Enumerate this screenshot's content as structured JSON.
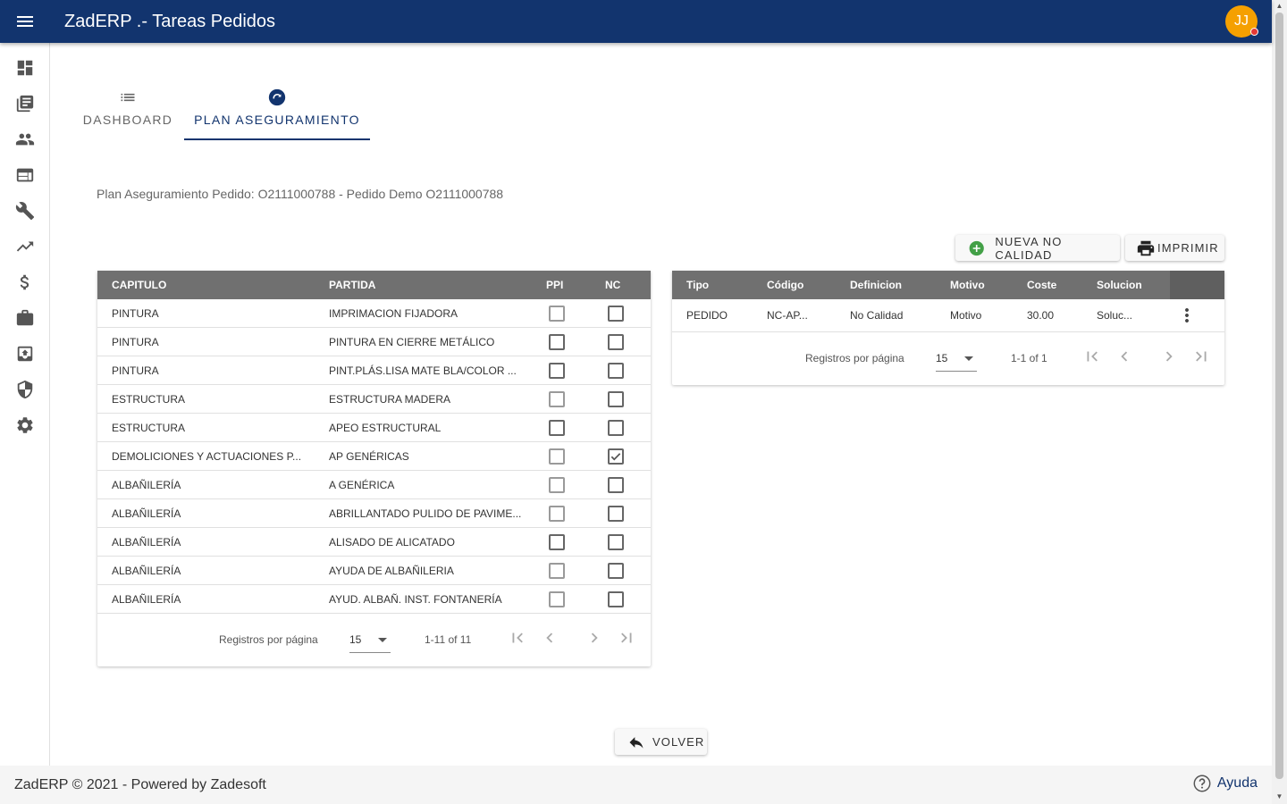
{
  "header": {
    "title": "ZadERP .- Tareas Pedidos",
    "avatar_initials": "JJ"
  },
  "sidebar": {
    "items": [
      {
        "name": "dashboard"
      },
      {
        "name": "library"
      },
      {
        "name": "people"
      },
      {
        "name": "web"
      },
      {
        "name": "wrench"
      },
      {
        "name": "trending"
      },
      {
        "name": "dollar"
      },
      {
        "name": "briefcase"
      },
      {
        "name": "archive"
      },
      {
        "name": "shield"
      },
      {
        "name": "settings"
      }
    ]
  },
  "tabs": [
    {
      "label": "DASHBOARD"
    },
    {
      "label": "PLAN ASEGURAMIENTO"
    }
  ],
  "subtitle": "Plan Aseguramiento Pedido: O2111000788 - Pedido Demo O2111000788",
  "actions": {
    "nueva_label": "NUEVA NO CALIDAD",
    "imprimir_label": "IMPRIMIR",
    "volver_label": "VOLVER"
  },
  "left_table": {
    "headers": {
      "capitulo": "CAPITULO",
      "partida": "PARTIDA",
      "ppi": "PPI",
      "nc": "NC"
    },
    "rows": [
      {
        "capitulo": "PINTURA",
        "partida": "IMPRIMACION FIJADORA",
        "ppi": false,
        "nc": false
      },
      {
        "capitulo": "PINTURA",
        "partida": "PINTURA EN CIERRE METÁLICO",
        "ppi": false,
        "nc": false
      },
      {
        "capitulo": "PINTURA",
        "partida": "PINT.PLÁS.LISA MATE BLA/COLOR ...",
        "ppi": false,
        "nc": false
      },
      {
        "capitulo": "ESTRUCTURA",
        "partida": "ESTRUCTURA MADERA",
        "ppi": false,
        "nc": false
      },
      {
        "capitulo": "ESTRUCTURA",
        "partida": "APEO ESTRUCTURAL",
        "ppi": false,
        "nc": false
      },
      {
        "capitulo": "DEMOLICIONES Y ACTUACIONES P...",
        "partida": "AP GENÉRICAS",
        "ppi": false,
        "nc": true
      },
      {
        "capitulo": "ALBAÑILERÍA",
        "partida": "A GENÉRICA",
        "ppi": false,
        "nc": false
      },
      {
        "capitulo": "ALBAÑILERÍA",
        "partida": "ABRILLANTADO PULIDO DE PAVIME...",
        "ppi": false,
        "nc": false
      },
      {
        "capitulo": "ALBAÑILERÍA",
        "partida": "ALISADO DE ALICATADO",
        "ppi": false,
        "nc": false
      },
      {
        "capitulo": "ALBAÑILERÍA",
        "partida": "AYUDA DE ALBAÑILERIA",
        "ppi": false,
        "nc": false
      },
      {
        "capitulo": "ALBAÑILERÍA",
        "partida": "AYUD. ALBAÑ. INST. FONTANERÍA",
        "ppi": false,
        "nc": false
      }
    ],
    "pager": {
      "label": "Registros por página",
      "page_size": "15",
      "range": "1-11 of 11"
    }
  },
  "right_table": {
    "headers": {
      "tipo": "Tipo",
      "codigo": "Código",
      "definicion": "Definicion",
      "motivo": "Motivo",
      "coste": "Coste",
      "solucion": "Solucion"
    },
    "rows": [
      {
        "tipo": "PEDIDO",
        "codigo": "NC-AP...",
        "definicion": "No Calidad",
        "motivo": "Motivo",
        "coste": "30.00",
        "solucion": "Soluc..."
      }
    ],
    "pager": {
      "label": "Registros por página",
      "page_size": "15",
      "range": "1-1 of 1"
    }
  },
  "footer": {
    "text": "ZadERP © 2021 - Powered by Zadesoft",
    "help_label": "Ayuda"
  }
}
